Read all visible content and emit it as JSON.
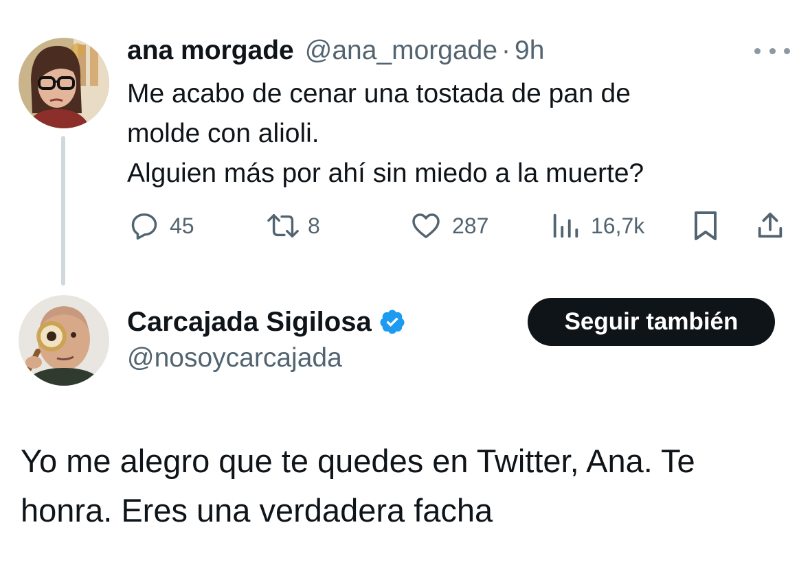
{
  "tweet_1": {
    "author_name": "ana morgade",
    "author_handle": "@ana_morgade",
    "separator": "·",
    "time": "9h",
    "more_icon": "more-horizontal-icon",
    "text_lines": [
      "Me acabo de cenar una tostada de pan de",
      "molde con alioli.",
      "Alguien más por ahí sin miedo a la muerte?"
    ],
    "actions": {
      "replies": {
        "icon": "reply-icon",
        "count": "45"
      },
      "retweets": {
        "icon": "retweet-icon",
        "count": "8"
      },
      "likes": {
        "icon": "heart-icon",
        "count": "287"
      },
      "views": {
        "icon": "views-chart-icon",
        "count": "16,7k"
      },
      "bookmark": {
        "icon": "bookmark-icon"
      },
      "share": {
        "icon": "share-icon"
      }
    }
  },
  "tweet_2": {
    "author_name": "Carcajada Sigilosa",
    "verified_icon": "verified-badge-icon",
    "author_handle": "@nosoycarcajada",
    "follow_button_label": "Seguir también",
    "text_lines": [
      "Yo me alegro que te quedes en Twitter, Ana. Te",
      "honra. Eres una verdadera facha"
    ]
  },
  "colors": {
    "text_primary": "#0f1419",
    "text_secondary": "#536471",
    "verified_blue": "#1d9bf0",
    "thread_line": "#cfd9de",
    "button_bg": "#0f1419",
    "button_text": "#ffffff"
  }
}
